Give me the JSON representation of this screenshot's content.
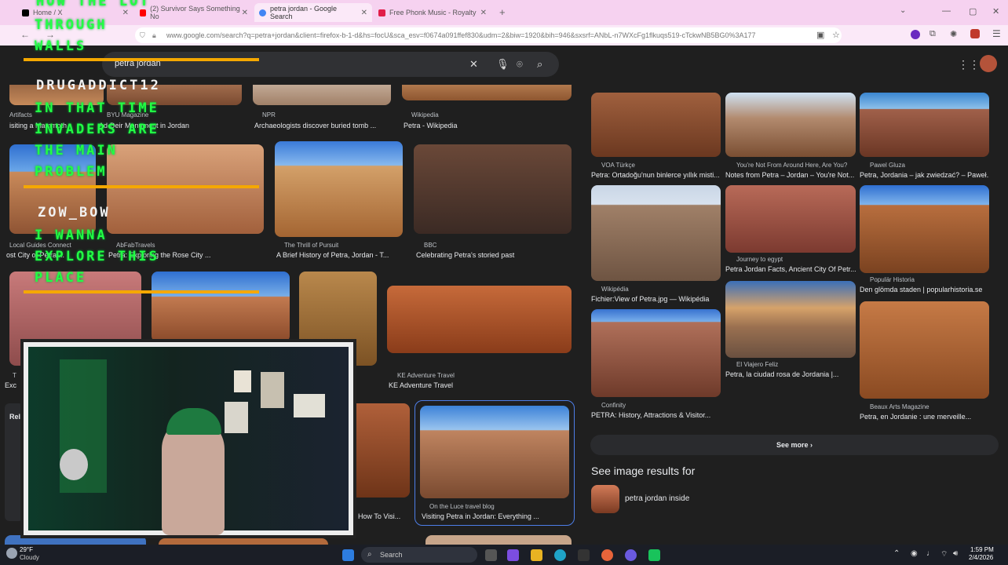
{
  "tabs": [
    {
      "label": "Home / X",
      "color": "#000000"
    },
    {
      "label": "(2) Survivor Says Something No",
      "color": "#ff0000"
    },
    {
      "label": "petra jordan - Google Search",
      "color": "#4285f4"
    },
    {
      "label": "Free Phonk Music - Royalty",
      "color": "#e11d48"
    }
  ],
  "address": {
    "url": "www.google.com/search?q=petra+jordan&client=firefox-b-1-d&hs=focU&sca_esv=f0674a091ffef830&udm=2&biw=1920&bih=946&sxsrf=ANbL-n7WXcFg1flkuqs519-cTckwNB5BG0%3A177"
  },
  "search": {
    "query": "petra jordan"
  },
  "overlay": {
    "lines_green": [
      "HOW THE LOT",
      "THROUGH",
      "WALLS"
    ],
    "user1": "DRUGADDICT12",
    "msg1": [
      "IN THAT TIME",
      "INVADERS ARE",
      "THE MAIN",
      "PROBLEM"
    ],
    "user2": "ZOW_BOW",
    "msg2": [
      "I WANNA",
      "EXPLORE THIS",
      "PLACE"
    ]
  },
  "left_results": [
    {
      "src": "Artifacts",
      "cap": "isiting a Mammoth"
    },
    {
      "src": "BYU Magazine",
      "cap": "Ad-Deir Monument in Jordan"
    },
    {
      "src": "NPR",
      "cap": "Archaeologists discover buried tomb ..."
    },
    {
      "src": "Wikipedia",
      "cap": "Petra - Wikipedia"
    },
    {
      "src": "Local Guides Connect",
      "cap": "ost City of Petra ..."
    },
    {
      "src": "AbFabTravels",
      "cap": "Petra: Exploring the Rose City ..."
    },
    {
      "src": "The Thrill of Pursuit",
      "cap": "A Brief History of Petra, Jordan - T..."
    },
    {
      "src": "BBC",
      "cap": "Celebrating Petra's storied past"
    },
    {
      "src": "KE Adventure Travel",
      "cap": "KE Adventure Travel"
    },
    {
      "src": "On the Luce travel blog",
      "cap": "Visiting Petra in Jordan: Everything ..."
    },
    {
      "src": "",
      "cap": "How To Visi..."
    },
    {
      "src": "T",
      "cap": "Exc"
    }
  ],
  "right_results": [
    {
      "src": "VOA Türkçe",
      "cap": "Petra: Ortadoğu'nun binlerce yıllık misti..."
    },
    {
      "src": "You're Not From Around Here, Are You?",
      "cap": "Notes from Petra – Jordan – You're Not..."
    },
    {
      "src": "Pawel Gluza",
      "cap": "Petra, Jordania – jak zwiedzać? – Paweł..."
    },
    {
      "src": "Wikipédia",
      "cap": "Fichier:View of Petra.jpg — Wikipédia"
    },
    {
      "src": "Journey to egypt",
      "cap": "Petra Jordan Facts, Ancient City Of Petr..."
    },
    {
      "src": "Populär Historia",
      "cap": "Den glömda staden | popularhistoria.se"
    },
    {
      "src": "El Viajero Feliz",
      "cap": "Petra, la ciudad rosa de Jordania |..."
    },
    {
      "src": "Confinity",
      "cap": "PETRA: History, Attractions & Visitor..."
    },
    {
      "src": "Beaux Arts Magazine",
      "cap": "Petra, en Jordanie : une merveille..."
    }
  ],
  "see_more": "See more",
  "see_image_results": "See image results for",
  "related_query": "petra jordan inside",
  "related_label": "Rel",
  "taskbar": {
    "temp": "29°F",
    "weather": "Cloudy",
    "search": "Search",
    "time": "1:59 PM",
    "date": "2/4/2026"
  }
}
